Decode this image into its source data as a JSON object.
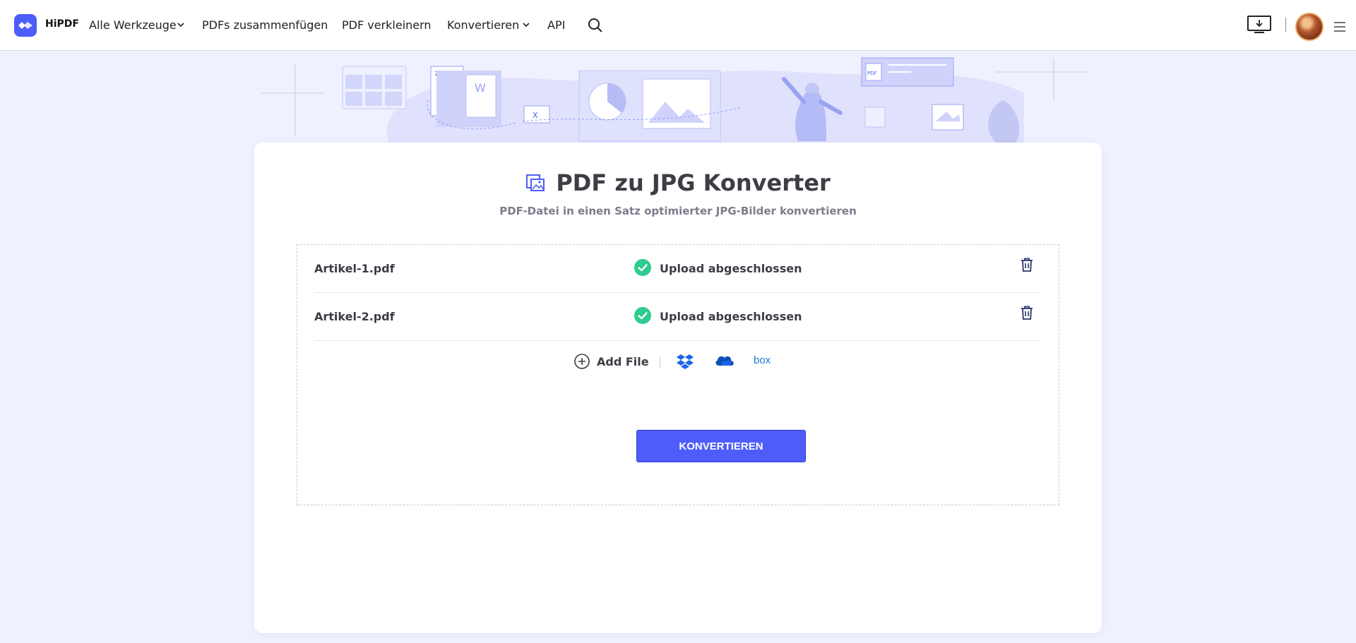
{
  "header": {
    "logo_text": "HiPDF",
    "nav": {
      "all_tools": "Alle Werkzeuge",
      "merge": "PDFs zusammenfügen",
      "compress": "PDF verkleinern",
      "convert": "Konvertieren",
      "api": "API"
    }
  },
  "main": {
    "title": "PDF zu JPG Konverter",
    "subtitle": "PDF-Datei in einen Satz optimierter JPG-Bilder konvertieren",
    "files": [
      {
        "name": "Artikel-1.pdf",
        "status": "Upload abgeschlossen"
      },
      {
        "name": "Artikel-2.pdf",
        "status": "Upload abgeschlossen"
      }
    ],
    "add_file_label": "Add File",
    "convert_button": "KONVERTIEREN"
  },
  "icons": {
    "logo": "hipdf-logo-icon",
    "search": "search-icon",
    "download": "desktop-download-icon",
    "menu": "hamburger-menu-icon",
    "success": "check-circle-icon",
    "delete": "trash-icon",
    "add": "plus-circle-icon",
    "dropbox": "dropbox-icon",
    "onedrive": "onedrive-icon",
    "box": "box-icon"
  },
  "colors": {
    "accent": "#4e5df9",
    "success": "#2ecb8f",
    "page_bg": "#f0f1fe",
    "icon_dark": "#2a2f6b"
  }
}
